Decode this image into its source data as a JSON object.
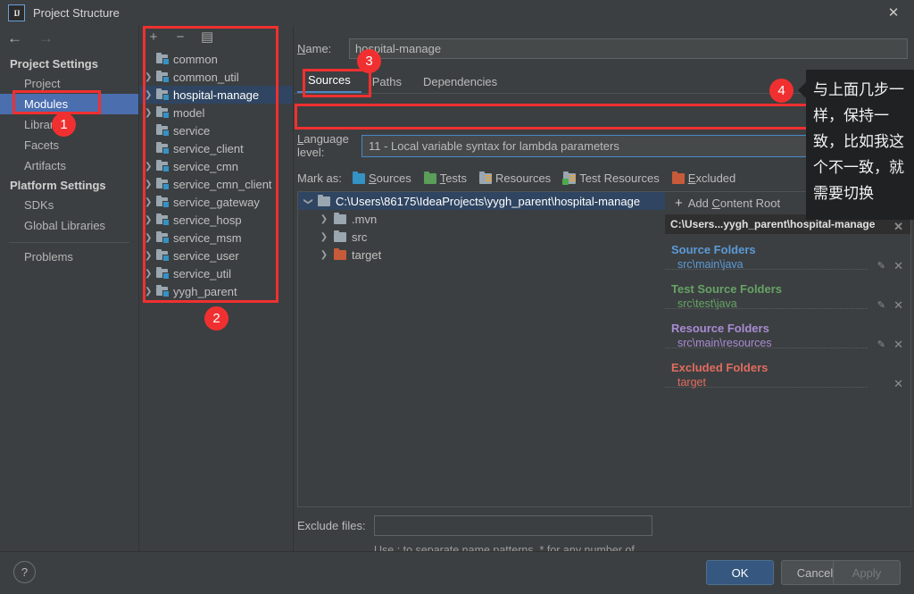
{
  "window": {
    "title": "Project Structure",
    "app_icon": "IJ",
    "close_icon": "✕"
  },
  "nav": {
    "back_icon": "←",
    "forward_icon": "→"
  },
  "sidebar": {
    "groups": [
      {
        "heading": "Project Settings",
        "items": [
          {
            "label": "Project",
            "selected": false
          },
          {
            "label": "Modules",
            "selected": true
          },
          {
            "label": "Libraries",
            "selected": false
          },
          {
            "label": "Facets",
            "selected": false
          },
          {
            "label": "Artifacts",
            "selected": false
          }
        ]
      },
      {
        "heading": "Platform Settings",
        "items": [
          {
            "label": "SDKs",
            "selected": false
          },
          {
            "label": "Global Libraries",
            "selected": false
          }
        ]
      }
    ],
    "problems": "Problems"
  },
  "module_panel": {
    "toolbar": {
      "add_icon": "+",
      "remove_icon": "−",
      "copy_icon": "▤"
    },
    "modules": [
      {
        "label": "common",
        "expandable": false,
        "selected": false
      },
      {
        "label": "common_util",
        "expandable": true,
        "selected": false
      },
      {
        "label": "hospital-manage",
        "expandable": true,
        "selected": true
      },
      {
        "label": "model",
        "expandable": true,
        "selected": false
      },
      {
        "label": "service",
        "expandable": false,
        "selected": false
      },
      {
        "label": "service_client",
        "expandable": false,
        "selected": false
      },
      {
        "label": "service_cmn",
        "expandable": true,
        "selected": false
      },
      {
        "label": "service_cmn_client",
        "expandable": true,
        "selected": false
      },
      {
        "label": "service_gateway",
        "expandable": true,
        "selected": false
      },
      {
        "label": "service_hosp",
        "expandable": true,
        "selected": false
      },
      {
        "label": "service_msm",
        "expandable": true,
        "selected": false
      },
      {
        "label": "service_user",
        "expandable": true,
        "selected": false
      },
      {
        "label": "service_util",
        "expandable": true,
        "selected": false
      },
      {
        "label": "yygh_parent",
        "expandable": true,
        "selected": false
      }
    ]
  },
  "detail": {
    "name_label": "Name:",
    "name_value": "hospital-manage",
    "tabs": [
      {
        "label": "Sources",
        "active": true
      },
      {
        "label": "Paths",
        "active": false
      },
      {
        "label": "Dependencies",
        "active": false
      }
    ],
    "language_level": {
      "label": "Language level:",
      "value": "11 - Local variable syntax for lambda parameters",
      "arrow_icon": "▼"
    },
    "mark_as": {
      "label": "Mark as:",
      "buttons": [
        {
          "label": "Sources",
          "color": "#3592c4"
        },
        {
          "label": "Tests",
          "color": "#5a9e5a"
        },
        {
          "label": "Resources",
          "color": "#9aa7b0"
        },
        {
          "label": "Test Resources",
          "color": "#9aa7b0"
        },
        {
          "label": "Excluded",
          "color": "#c75b39"
        }
      ]
    },
    "content_tree": [
      {
        "label": "C:\\Users\\86175\\IdeaProjects\\yygh_parent\\hospital-manage",
        "depth": 0,
        "selected": true,
        "expanded": true,
        "color": "#9aa7b0"
      },
      {
        "label": ".mvn",
        "depth": 1,
        "selected": false,
        "expanded": false,
        "color": "#9aa7b0"
      },
      {
        "label": "src",
        "depth": 1,
        "selected": false,
        "expanded": false,
        "color": "#9aa7b0"
      },
      {
        "label": "target",
        "depth": 1,
        "selected": false,
        "expanded": false,
        "color": "#c75b39"
      }
    ],
    "roots_panel": {
      "add_content_root": "Add Content Root",
      "add_icon": "+",
      "content_root_path": "C:\\Users...yygh_parent\\hospital-manage",
      "remove_icon": "✕",
      "edit_icon": "✎",
      "groups": [
        {
          "title": "Source Folders",
          "kind": "src",
          "entries": [
            "src\\main\\java"
          ]
        },
        {
          "title": "Test Source Folders",
          "kind": "test",
          "entries": [
            "src\\test\\java"
          ]
        },
        {
          "title": "Resource Folders",
          "kind": "res",
          "entries": [
            "src\\main\\resources"
          ]
        },
        {
          "title": "Excluded Folders",
          "kind": "exc",
          "entries": [
            "target"
          ]
        }
      ]
    },
    "exclude_files": {
      "label": "Exclude files:",
      "value": "",
      "hint": "Use ; to separate name patterns, * for any number of symbols, ? for one."
    }
  },
  "footer": {
    "help_icon": "?",
    "ok": "OK",
    "cancel": "Cancel",
    "apply": "Apply"
  },
  "annotations": {
    "accent_color": "#f03030",
    "badges": [
      {
        "n": "1"
      },
      {
        "n": "2"
      },
      {
        "n": "3"
      },
      {
        "n": "4"
      }
    ],
    "tooltip_text": "与上面几步一样，保持一致，比如我这个不一致，就需要切换"
  }
}
